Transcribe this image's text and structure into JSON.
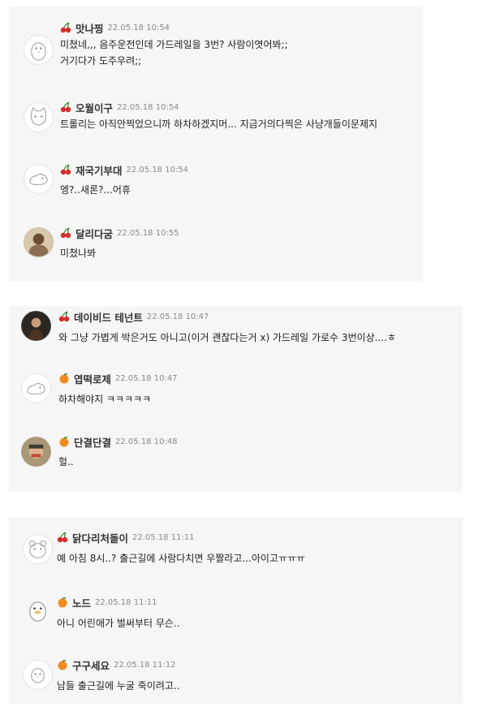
{
  "groups": [
    {
      "comments": [
        {
          "badge": "cherry",
          "avatar_icon": "penguin-icon",
          "nickname": "맛나찡",
          "time": "22.05.18 10:54",
          "lines": [
            "미쳤네,,, 음주운전인데 가드레일을 3번? 사람이엿어봐;;",
            "거기다가 도주우려;;"
          ]
        },
        {
          "badge": "cherry",
          "avatar_icon": "cat-icon",
          "nickname": "오월이구",
          "time": "22.05.18 10:54",
          "lines": [
            "트롤리는 아직안찍었으니까 하차하겠지머... 지금거의다찍은 사냥개들이문제지"
          ]
        },
        {
          "badge": "cherry",
          "avatar_icon": "dinosaur-icon",
          "nickname": "재국기부대",
          "time": "22.05.18 10:54",
          "lines": [
            "엥?..새론?...어휴"
          ]
        },
        {
          "badge": "cherry",
          "avatar_icon": "photo-avatar-icon",
          "nickname": "달리다굼",
          "time": "22.05.18 10:55",
          "lines": [
            "미쳤나봐"
          ]
        }
      ]
    },
    {
      "comments": [
        {
          "badge": "cherry",
          "avatar_icon": "photo-avatar-icon",
          "nickname": "데이비드 테넌트",
          "time": "22.05.18 10:47",
          "lines": [
            "와 그냥 가볍게 박은거도 아니고(이거 괜찮다는거 x) 가드레일 가로수 3번이상....ㅎ"
          ]
        },
        {
          "badge": "tangerine",
          "avatar_icon": "dinosaur-icon",
          "nickname": "엽떡로제",
          "time": "22.05.18 10:47",
          "lines": [
            "하차해야지 ㅋㅋㅋㅋㅋ"
          ]
        },
        {
          "badge": "tangerine",
          "avatar_icon": "photo-avatar-icon",
          "nickname": "단결단결",
          "time": "22.05.18 10:48",
          "lines": [
            "헐.."
          ]
        }
      ]
    },
    {
      "comments": [
        {
          "badge": "cherry",
          "avatar_icon": "bear-icon",
          "nickname": "닭다리처돌이",
          "time": "22.05.18 11:11",
          "lines": [
            "예 아침 8시..? 출근길에 사람다치면 우짤라고...아이고ㅠㅠㅠ"
          ]
        },
        {
          "badge": "tangerine",
          "avatar_icon": "duck-icon",
          "nickname": "노드",
          "time": "22.05.18 11:11",
          "lines": [
            "아니 어린애가 벌써부터 무슨.."
          ]
        },
        {
          "badge": "tangerine",
          "avatar_icon": "chick-icon",
          "nickname": "구구세요",
          "time": "22.05.18 11:12",
          "lines": [
            "남들 출근길에 누굴 죽이려고.."
          ]
        }
      ]
    }
  ]
}
